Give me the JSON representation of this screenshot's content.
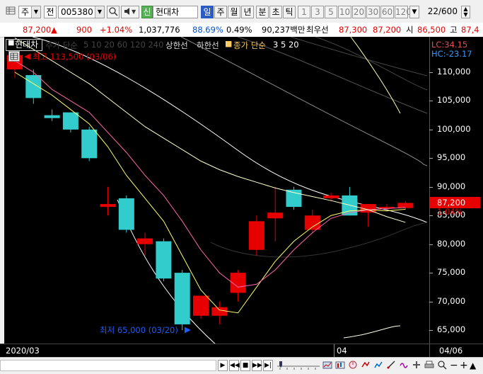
{
  "toolbar": {
    "market_select": "주",
    "type_select": "전",
    "code_input": "005380",
    "speaker_icon": "speaker-icon",
    "new_badge": "신",
    "stock_name": "현대차",
    "periods": [
      "일",
      "주",
      "월",
      "년",
      "분",
      "초",
      "틱"
    ],
    "selected_period": "일",
    "intervals": [
      "1",
      "3",
      "5",
      "10",
      "20",
      "30",
      "60",
      "120"
    ],
    "count_value": "22",
    "count_total": "/600"
  },
  "infobar": {
    "price": "87,200",
    "change": "900",
    "change_pct": "+1.04%",
    "volume": "1,037,776",
    "vol_ratio": "88.69%",
    "turnover": "0.49%",
    "amount": "90,237백만",
    "pref_label": "최우선",
    "ask": "87,300",
    "bid": "87,200",
    "low_label": "시",
    "low_value": "86,500",
    "high_label": "고",
    "high_value": "87,4"
  },
  "legend": {
    "name": "현대차",
    "ma_label": "주가 단순",
    "ma_periods": "5 10 20 60 120 240",
    "limit_up": "상한선",
    "limit_down": "하한선",
    "close_ma_label": "종가 단순",
    "close_ma_periods": "3 5 20",
    "lc": "LC:34.15",
    "hc": "HC:-23.17"
  },
  "annotations": {
    "max_label": "최고 113,500 (03/06)",
    "min_label": "최저 65,000 (03/20)",
    "current_price": "87,200",
    "current_pct": "1.04%"
  },
  "xaxis": {
    "start_label": "2020/03",
    "mid_label": "04",
    "end_label": "04/06"
  },
  "colors": {
    "up": "#e60000",
    "down": "#33cccc",
    "ma5": "#ffff66",
    "ma10": "#ff66aa",
    "ma20": "#ffffcc",
    "ma60": "#ffffff",
    "ma120": "#ffffee"
  },
  "chart_data": {
    "type": "candlestick",
    "yaxis_ticks": [
      "110,000",
      "105,000",
      "100,000",
      "95,000",
      "90,000",
      "85,000",
      "80,000",
      "75,000",
      "70,000",
      "65,000"
    ],
    "ylim": [
      63000,
      115000
    ],
    "candles": [
      {
        "o": 110500,
        "h": 113500,
        "l": 109000,
        "c": 113000
      },
      {
        "o": 109500,
        "h": 110500,
        "l": 104500,
        "c": 105500
      },
      {
        "o": 102500,
        "h": 103500,
        "l": 101500,
        "c": 102000
      },
      {
        "o": 103000,
        "h": 103000,
        "l": 99500,
        "c": 100000
      },
      {
        "o": 100000,
        "h": 100500,
        "l": 94500,
        "c": 95000
      },
      {
        "o": 86500,
        "h": 90000,
        "l": 85000,
        "c": 87000
      },
      {
        "o": 88000,
        "h": 88500,
        "l": 82000,
        "c": 82500
      },
      {
        "o": 80000,
        "h": 82000,
        "l": 78000,
        "c": 81000
      },
      {
        "o": 80500,
        "h": 81000,
        "l": 73500,
        "c": 74000
      },
      {
        "o": 75000,
        "h": 75500,
        "l": 65000,
        "c": 66000
      },
      {
        "o": 67500,
        "h": 71000,
        "l": 67000,
        "c": 71000
      },
      {
        "o": 67500,
        "h": 70000,
        "l": 66000,
        "c": 69000
      },
      {
        "o": 71500,
        "h": 75500,
        "l": 70000,
        "c": 75000
      },
      {
        "o": 79000,
        "h": 85000,
        "l": 78000,
        "c": 84000
      },
      {
        "o": 84500,
        "h": 90000,
        "l": 80500,
        "c": 85500
      },
      {
        "o": 89500,
        "h": 90000,
        "l": 86000,
        "c": 86500
      },
      {
        "o": 82500,
        "h": 86000,
        "l": 82000,
        "c": 85000
      },
      {
        "o": 88000,
        "h": 89000,
        "l": 87500,
        "c": 88500
      },
      {
        "o": 88500,
        "h": 90000,
        "l": 85000,
        "c": 85000
      },
      {
        "o": 85500,
        "h": 87000,
        "l": 83000,
        "c": 87000
      },
      {
        "o": 86500,
        "h": 87000,
        "l": 86000,
        "c": 86500
      },
      {
        "o": 86300,
        "h": 87500,
        "l": 86000,
        "c": 87200
      }
    ],
    "ma5": [
      110000,
      108000,
      106000,
      103500,
      101000,
      97000,
      92000,
      88000,
      84000,
      78000,
      72000,
      68500,
      68000,
      72500,
      77000,
      80500,
      83000,
      85000,
      85800,
      86000,
      85800,
      86100
    ],
    "ma10": [
      112000,
      110000,
      107000,
      105000,
      103000,
      99500,
      96000,
      92000,
      88500,
      84000,
      79000,
      75000,
      72500,
      73000,
      75500,
      79000,
      82000,
      84500,
      85500,
      86000,
      86200,
      86400
    ],
    "ma20": [
      116000,
      114000,
      112000,
      110000,
      108000,
      105500,
      103000,
      100500,
      98500,
      96500,
      94500,
      93000,
      91800,
      90800,
      89800,
      89000,
      88300,
      87600,
      86800,
      86000,
      84800,
      83800
    ]
  }
}
